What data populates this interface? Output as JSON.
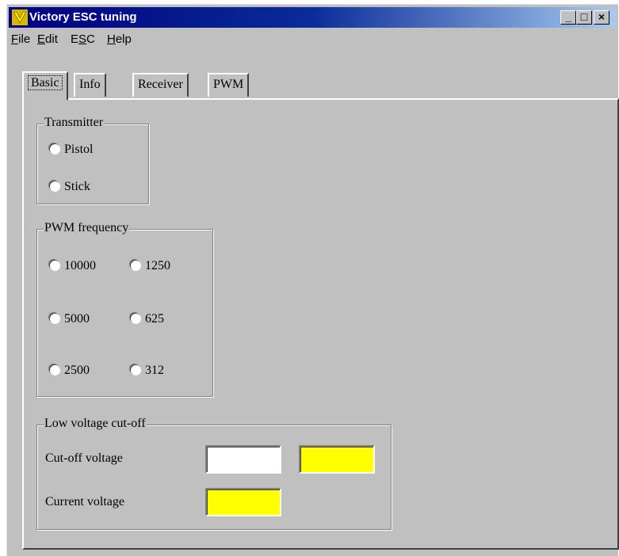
{
  "window": {
    "title": "Victory ESC tuning",
    "controls": {
      "minimize": "_",
      "maximize": "□",
      "close": "×"
    }
  },
  "menu": [
    {
      "label_pre": "",
      "label_u": "F",
      "label_post": "ile"
    },
    {
      "label_pre": "",
      "label_u": "E",
      "label_post": "dit"
    },
    {
      "label_pre": "E",
      "label_u": "S",
      "label_post": "C"
    },
    {
      "label_pre": "",
      "label_u": "H",
      "label_post": "elp"
    }
  ],
  "tabs": [
    {
      "label": "Basic",
      "active": true
    },
    {
      "label": "Info",
      "active": false
    },
    {
      "label": "Receiver",
      "active": false
    },
    {
      "label": "PWM",
      "active": false
    }
  ],
  "transmitter": {
    "legend": "Transmitter",
    "options": [
      "Pistol",
      "Stick"
    ]
  },
  "pwm_frequency": {
    "legend": "PWM frequency",
    "options": [
      "10000",
      "1250",
      "5000",
      "625",
      "2500",
      "312"
    ]
  },
  "low_voltage": {
    "legend": "Low voltage cut-off",
    "cutoff_label": "Cut-off voltage",
    "current_label": "Current voltage",
    "cutoff_value": "",
    "cutoff_indicator": "",
    "current_value": ""
  },
  "colors": {
    "indicator": "#ffff00",
    "titlebar_start": "#000080",
    "face": "#c0c0c0"
  }
}
